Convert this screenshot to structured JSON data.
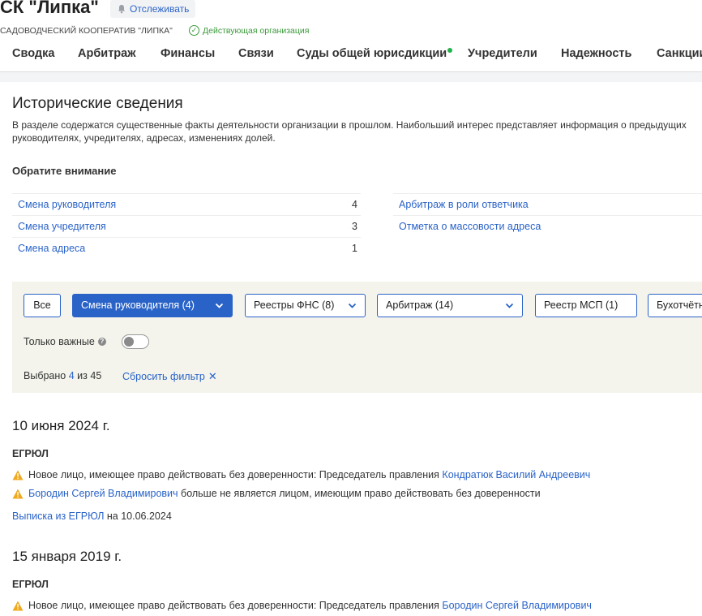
{
  "org": {
    "title": "СК \"Липка\"",
    "full_name": "САДОВОДЧЕСКИЙ КООПЕРАТИВ \"ЛИПКА\"",
    "status": "Действующая организация",
    "track_label": "Отслеживать"
  },
  "tabs": [
    {
      "label": "Сводка"
    },
    {
      "label": "Арбитраж"
    },
    {
      "label": "Финансы"
    },
    {
      "label": "Связи"
    },
    {
      "label": "Суды общей юрисдикции",
      "has_dot": true
    },
    {
      "label": "Учредители"
    },
    {
      "label": "Надежность"
    },
    {
      "label": "Санкции"
    }
  ],
  "section": {
    "title": "Исторические сведения",
    "description": "В разделе содержатся существенные факты деятельности организации в прошлом. Наибольший интерес представляет информация о предыдущих руководителях, учредителях, адресах, изменениях долей."
  },
  "attention": {
    "title": "Обратите внимание",
    "left": [
      {
        "label": "Смена руководителя",
        "count": "4"
      },
      {
        "label": "Смена учредителя",
        "count": "3"
      },
      {
        "label": "Смена адреса",
        "count": "1"
      }
    ],
    "right": [
      {
        "label": "Арбитраж в роли ответчика"
      },
      {
        "label": "Отметка о массовости адреса"
      }
    ]
  },
  "filters": {
    "chips": [
      {
        "label": "Все"
      },
      {
        "label": "Смена руководителя (4)",
        "active": true
      },
      {
        "label": "Реестры ФНС (8)"
      },
      {
        "label": "Арбитраж (14)"
      },
      {
        "label": "Реестр МСП (1)"
      },
      {
        "label": "Бухотчётность"
      }
    ],
    "important_only_label": "Только важные",
    "important_only": false,
    "selected_prefix": "Выбрано",
    "selected_count": "4",
    "selected_mid": "из",
    "selected_total": "45",
    "reset_label": "Сбросить фильтр"
  },
  "events": [
    {
      "date": "10 июня 2024 г.",
      "source": "ЕГРЮЛ",
      "lines": [
        {
          "text": "Новое лицо, имеющее право действовать без доверенности: Председатель правления",
          "person": "Кондратюк Василий Андреевич",
          "person_first": false
        },
        {
          "text": "больше не является лицом, имеющим право действовать без доверенности",
          "person": "Бородин Сергей Владимирович",
          "person_first": true
        }
      ],
      "extract_link": "Выписка из ЕГРЮЛ",
      "extract_suffix": "на 10.06.2024"
    },
    {
      "date": "15 января 2019 г.",
      "source": "ЕГРЮЛ",
      "lines": [
        {
          "text": "Новое лицо, имеющее право действовать без доверенности: Председатель правления",
          "person": "Бородин Сергей Владимирович",
          "person_first": false
        }
      ]
    }
  ],
  "colors": {
    "link": "#2a63c8",
    "warning": "#f0a81c",
    "status_green": "#3a9a3a",
    "tab_dot": "#22b24c",
    "filter_bg": "#f4f4ec"
  }
}
